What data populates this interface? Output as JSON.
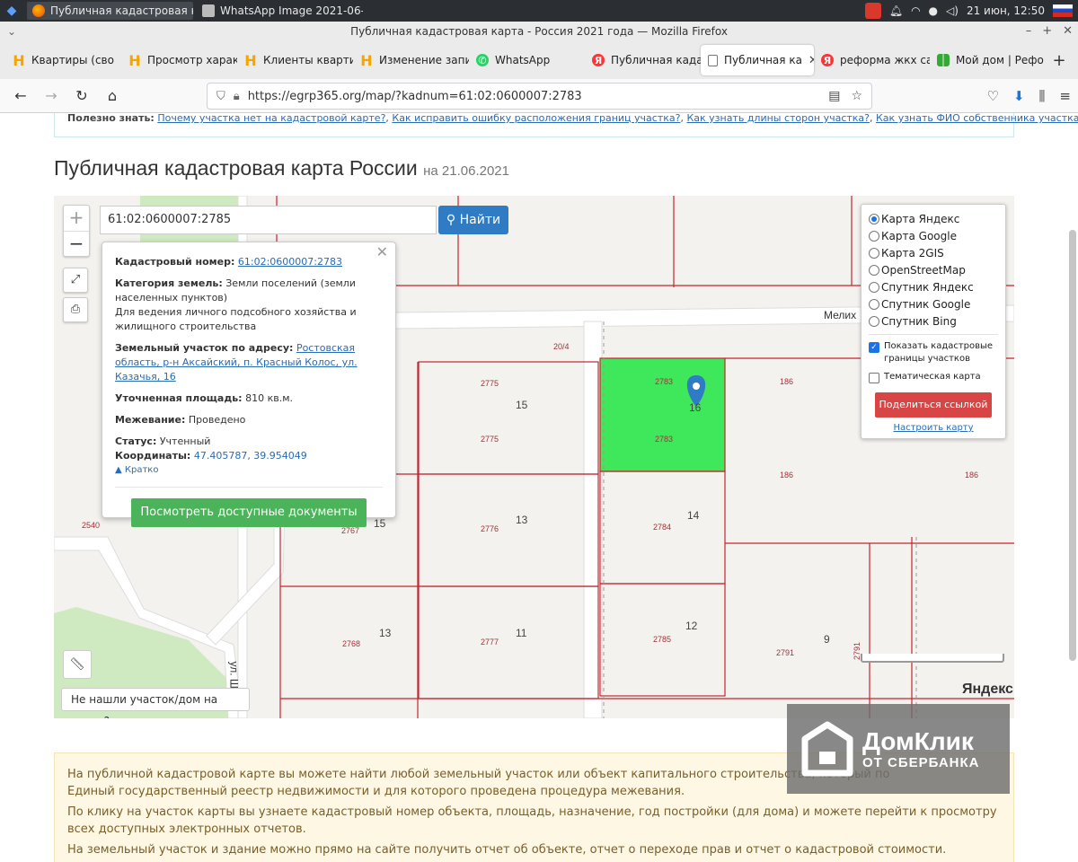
{
  "taskbar": {
    "tasks": [
      {
        "label": "Публичная кадастровая к..."
      },
      {
        "label": "WhatsApp Image 2021-06-2..."
      }
    ],
    "clock": "21 июн, 12:50"
  },
  "window": {
    "title": "Публичная кадастровая карта - Россия 2021 года — Mozilla Firefox"
  },
  "tabs": [
    {
      "label": "Квартиры (сво",
      "icon": "h-icon"
    },
    {
      "label": "Просмотр харак",
      "icon": "h-icon"
    },
    {
      "label": "Клиенты кварти",
      "icon": "h-icon"
    },
    {
      "label": "Изменение запи",
      "icon": "h-icon"
    },
    {
      "label": "WhatsApp",
      "icon": "whatsapp-icon"
    },
    {
      "label": "Публичная када",
      "icon": "yandex-icon"
    },
    {
      "label": "Публичная ка",
      "icon": "document-icon",
      "active": true
    },
    {
      "label": "реформа жкх са",
      "icon": "yandex-icon"
    },
    {
      "label": "Мой дом | Рефо",
      "icon": "grid-icon"
    }
  ],
  "nav": {
    "url": "https://egrp365.org/map/?kadnum=61:02:0600007:2783"
  },
  "useful": {
    "label": "Полезно знать:",
    "links": [
      "Почему участка нет на кадастровой карте?",
      "Как исправить ошибку расположения границ участка?",
      "Как узнать длины сторон участка?",
      "Как узнать ФИО собственника участка?"
    ]
  },
  "heading": {
    "title": "Публичная кадастровая карта России",
    "date": "на 21.06.2021"
  },
  "map": {
    "search_value": "61:02:0600007:2785",
    "find_label": "Найти",
    "popup": {
      "cad_label": "Кадастровый номер:",
      "cad_value": "61:02:0600007:2783",
      "category_label": "Категория земель:",
      "category_value": "Земли поселений (земли населенных пунктов)",
      "usage_value": "Для ведения личного подсобного хозяйства и жилищного строительства",
      "address_label": "Земельный участок по адресу:",
      "address_value": "Ростовская область, р-н Аксайский, п. Красный Колос, ул. Казачья, 16",
      "area_label": "Уточненная площадь:",
      "area_value": "810 кв.м.",
      "survey_label": "Межевание:",
      "survey_value": "Проведено",
      "status_label": "Статус:",
      "status_value": "Учтенный",
      "coords_label": "Координаты:",
      "coords_value": "47.405787, 39.954049",
      "collapse_label": "Кратко",
      "docs_button": "Посмотреть доступные документы"
    },
    "layers": {
      "options": [
        {
          "label": "Карта Яндекс",
          "selected": true
        },
        {
          "label": "Карта Google",
          "selected": false
        },
        {
          "label": "Карта 2GIS",
          "selected": false
        },
        {
          "label": "OpenStreetMap",
          "selected": false
        },
        {
          "label": "Спутник Яндекс",
          "selected": false
        },
        {
          "label": "Спутник Google",
          "selected": false
        },
        {
          "label": "Спутник Bing",
          "selected": false
        }
      ],
      "show_borders": "Показать кадастровые границы участков",
      "thematic": "Тематическая карта",
      "share_button": "Поделиться ссылкой",
      "configure_link": "Настроить карту"
    },
    "parcel_labels": [
      "20/4",
      "2775",
      "2775",
      "2783",
      "2783",
      "186",
      "186",
      "186",
      "2540",
      "2767",
      "2776",
      "2784",
      "2768",
      "2777",
      "2785",
      "2791",
      "2791"
    ],
    "house_labels": [
      "15",
      "16",
      "15",
      "13",
      "14",
      "13",
      "11",
      "12",
      "9"
    ],
    "street_labels": [
      "Мелих",
      "ул. Шо"
    ],
    "not_found": "Не нашли участок/дом на карте?",
    "provider": "Яндекс"
  },
  "info": {
    "p1a": "На публичной кадастровой карте вы можете найти любой земельный участок или объект капитального строительства, который по",
    "p1b": "Единый государственный реестр недвижимости и для которого проведена процедура межевания.",
    "p2": "По клику на участок карты вы узнаете кадастровый номер объекта, площадь, назначение, год постройки (для дома) и можете перейти к просмотру всех доступных электронных отчетов.",
    "p3": "На земельный участок и здание можно прямо на сайте получить отчет об объекте, отчет о переходе прав и отчет о кадастровой стоимости."
  },
  "watermark": {
    "line1": "ДомКлик",
    "line2": "ОТ СБЕРБАНКА"
  },
  "colors": {
    "selected_parcel": "#3ee85a",
    "parcel_border": "#c0262f",
    "button_blue": "#2f7bc4",
    "button_green": "#4bb35a",
    "button_red": "#d84545"
  }
}
